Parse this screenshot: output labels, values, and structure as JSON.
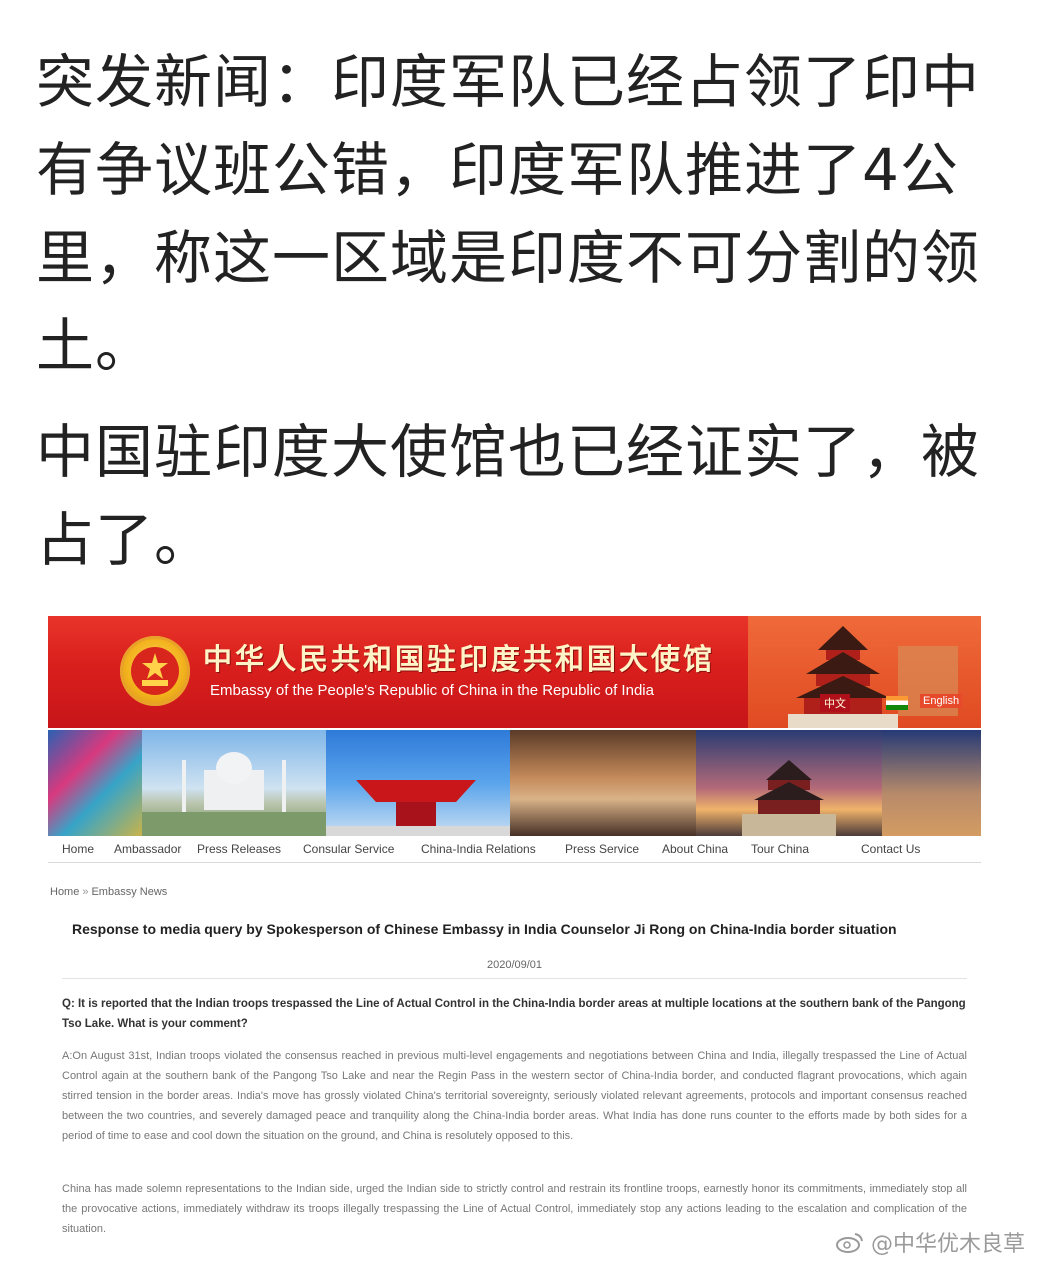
{
  "post": {
    "paragraph1": "突发新闻：印度军队已经占领了印中有争议班公错，印度军队推进了4公里，称这一区域是印度不可分割的领土。",
    "paragraph2": "中国驻印度大使馆也已经证实了，被占了。"
  },
  "embassy_banner": {
    "title_cn": "中华人民共和国驻印度共和国大使馆",
    "title_en": "Embassy of the People's Republic of China in the Republic of India",
    "lang_cn": "中文",
    "lang_en": "English"
  },
  "nav": {
    "items": [
      "Home",
      "Ambassador",
      "Press Releases",
      "Consular Service",
      "China-India Relations",
      "Press Service",
      "About China",
      "Tour China",
      "Contact Us"
    ]
  },
  "breadcrumb": {
    "home": "Home",
    "separator": "»",
    "section": "Embassy News"
  },
  "article": {
    "title": "Response to media query by Spokesperson of Chinese Embassy in India Counselor Ji Rong on China-India border situation",
    "date": "2020/09/01",
    "question": "Q: It is reported that the Indian troops trespassed the Line of Actual Control in the China-India border areas at multiple locations at the southern bank of the Pangong Tso Lake. What is your comment?",
    "answer_p1": "A:On August 31st, Indian troops violated the consensus reached in previous multi-level engagements and negotiations between China and India, illegally trespassed the Line of Actual Control again at the southern bank of the Pangong Tso Lake and near the Regin Pass in the western sector of China-India border, and conducted flagrant provocations, which again stirred tension in the border areas. India's move has grossly violated China's territorial sovereignty, seriously violated relevant agreements, protocols and important consensus reached between the two countries, and severely damaged peace and tranquility along the China-India border areas. What India has done runs counter to the efforts made by both sides for a period of time to ease and cool down the situation on the ground, and China is resolutely opposed to this.",
    "answer_p2": "China has made solemn representations to the Indian side, urged the Indian side to strictly control and restrain its frontline troops, earnestly honor its commitments, immediately stop all the provocative actions, immediately withdraw its troops illegally trespassing the Line of Actual Control, immediately stop any actions leading to the escalation and complication of the situation."
  },
  "watermark": {
    "text": "@中华优木良草",
    "icon": "weibo-icon"
  }
}
